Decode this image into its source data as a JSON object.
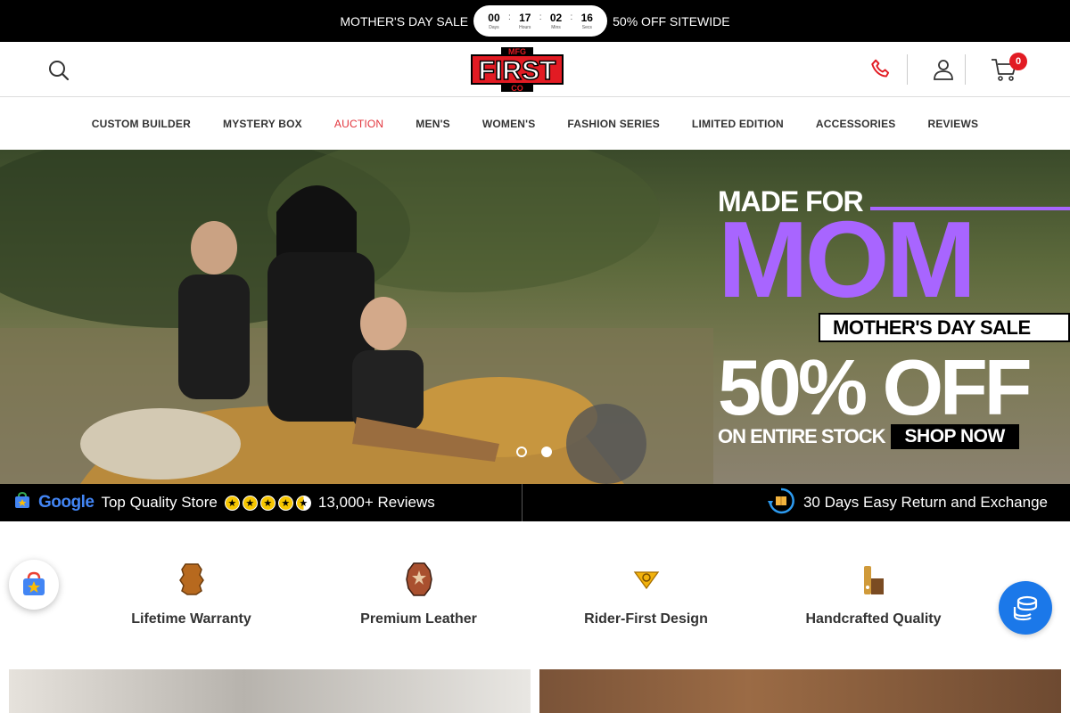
{
  "announcement": {
    "left_text": "MOTHER'S DAY SALE",
    "right_text": "50% OFF SITEWIDE",
    "countdown": [
      {
        "value": "00",
        "label": "Days"
      },
      {
        "value": "17",
        "label": "Hours"
      },
      {
        "value": "02",
        "label": "Mins"
      },
      {
        "value": "16",
        "label": "Secs"
      }
    ]
  },
  "header": {
    "logo": {
      "top": "MFG",
      "main": "FIRST",
      "bottom": "CO"
    },
    "cart_count": "0",
    "icons": [
      "search-icon",
      "phone-icon",
      "account-icon",
      "cart-icon"
    ],
    "accent_color": "#e21b23"
  },
  "nav": [
    {
      "label": "CUSTOM BUILDER"
    },
    {
      "label": "MYSTERY BOX"
    },
    {
      "label": "AUCTION"
    },
    {
      "label": "MEN'S"
    },
    {
      "label": "WOMEN'S"
    },
    {
      "label": "FASHION SERIES"
    },
    {
      "label": "LIMITED EDITION"
    },
    {
      "label": "ACCESSORIES"
    },
    {
      "label": "REVIEWS"
    }
  ],
  "hero": {
    "made_for": "MADE FOR",
    "mom": "MOM",
    "sale": "MOTHER'S DAY SALE",
    "off": "50% OFF",
    "stock": "ON ENTIRE STOCK",
    "cta": "SHOP NOW",
    "accent_color": "#a865ff",
    "slides": 2,
    "active_slide": 1
  },
  "trust": {
    "google": "Google",
    "quality": "Top Quality Store",
    "reviews": "13,000+ Reviews",
    "returns": "30 Days Easy Return and Exchange"
  },
  "features": [
    {
      "label": "Lifetime Warranty",
      "icon": "leather-hide-icon"
    },
    {
      "label": "Premium Leather",
      "icon": "leather-badge-icon"
    },
    {
      "label": "Rider-First Design",
      "icon": "shield-badge-icon"
    },
    {
      "label": "Handcrafted Quality",
      "icon": "craft-tools-icon"
    }
  ]
}
